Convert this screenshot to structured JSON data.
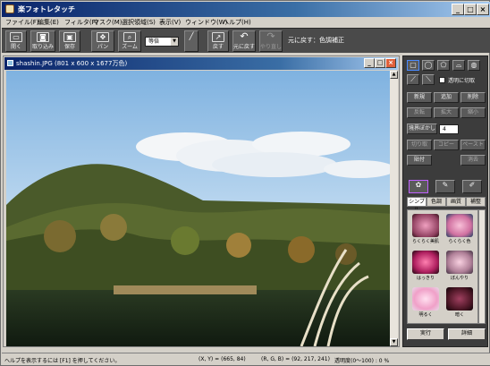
{
  "app": {
    "title": "楽フォトレタッチ"
  },
  "menu": [
    "ファイル(F)",
    "編集(E)",
    "フィルタ(P)",
    "マスク(M)",
    "選択領域(S)",
    "表示(V)",
    "ウィンドウ(W)",
    "ヘルプ(H)"
  ],
  "toolbar": {
    "buttons": [
      "開く",
      "取り込み",
      "保存",
      "パン",
      "ズーム",
      "戻す",
      "元に戻す",
      "やり直し"
    ],
    "zoom_value": "等倍",
    "undo_label": "元に戻す：色調補正"
  },
  "document": {
    "title": "shashin.JPG (801 x 600 x 1677万色)"
  },
  "panel": {
    "transparent_checkbox": "透明に切取",
    "buttons_row1": [
      "新規",
      "追加",
      "削除"
    ],
    "buttons_row2": [
      "反転",
      "拡大",
      "縮小"
    ],
    "blur_label": "境界ぼかし",
    "blur_value": "4",
    "buttons_row3": [
      "切り取",
      "コピー",
      "ペースト"
    ],
    "buttons_row4": [
      "貼付",
      "消去"
    ],
    "tabs": [
      "シンプル",
      "色調",
      "画質",
      "補整"
    ],
    "effects": [
      "らくらく美肌",
      "らくらく色",
      "はっきり",
      "ぼんやり",
      "明るく",
      "暗く"
    ],
    "apply_button": "実行",
    "detail_button": "詳細"
  },
  "statusbar": {
    "help": "ヘルプを表示するには [F1] を押してください。",
    "coords": "(X, Y) = (665, 84)",
    "rgb": "(R, G, B) = (92, 217, 241)",
    "opacity": "透明度(0～100) : 0 %"
  },
  "colors": {
    "titlebar": "#0a246a",
    "panel": "#3c3c3c",
    "toolbar": "#4a4a4a"
  }
}
